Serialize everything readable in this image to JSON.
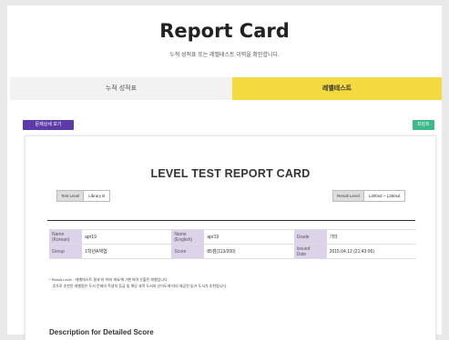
{
  "header": {
    "title": "Report Card",
    "subtitle": "누적 성적표 또는 레벨테스트 이력을 확인합니다."
  },
  "tabs": [
    {
      "label": "누적 성적표",
      "active": false
    },
    {
      "label": "레벨테스트",
      "active": true
    }
  ],
  "actions": {
    "detail_button": "문제상세 보기",
    "print_button": "프린트"
  },
  "report": {
    "title": "LEVEL TEST REPORT CARD",
    "test_level_label": "Test Level",
    "test_level_value": "Library B",
    "result_level_label": "Result Level",
    "result_level_value": "L300xd ~ L350xd",
    "rows": [
      [
        {
          "key": "Name\n(Korean)",
          "value": "apr19"
        },
        {
          "key": "Name\n(English)",
          "value": "apr19"
        },
        {
          "key": "Grade",
          "value": "기타"
        }
      ],
      [
        {
          "key": "Group",
          "value": "1학년A체험"
        },
        {
          "key": "Score",
          "value": "85점(113/200)"
        },
        {
          "key": "Issued\nDate",
          "value": "2015.04.12 (21:43:06)"
        }
      ]
    ],
    "notes": [
      "* Result Level : '레벨테스트 결과'와 '여러 개요'에 기반하여 산출된 레벨입니다.",
      "   추가로 추천된 레벨명은 도서 문제의 학생의 등급 및 해당 과목 도서의 난이도에 따라 제공된 읽기 도서가 추천됩니다."
    ],
    "description_heading": "Description for Detailed Score"
  },
  "colors": {
    "active_tab": "#f3da41",
    "detail_button": "#5e3aa8",
    "print_button": "#3fb98a",
    "table_key_bg": "#dcd3ea"
  }
}
